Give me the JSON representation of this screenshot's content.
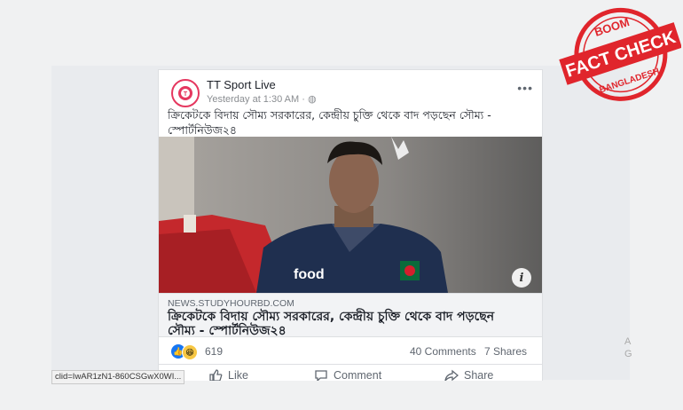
{
  "post": {
    "page_name": "TT Sport Live",
    "timestamp": "Yesterday at 1:30 AM · ",
    "more_label": "•••",
    "caption": "ক্রিকেটকে বিদায় সৌম্য সরকারের, কেন্দ্রীয় চুক্তি থেকে বাদ পড়ছেন সৌম্য - স্পোর্টনিউজ২৪",
    "info_label": "i"
  },
  "link_preview": {
    "domain": "NEWS.STUDYHOURBD.COM",
    "title": "ক্রিকেটকে বিদায় সৌম্য সরকারের, কেন্দ্রীয় চুক্তি থেকে বাদ পড়ছেন সৌম্য - স্পোর্টনিউজ২৪"
  },
  "stats": {
    "reaction_count": "619",
    "comments": "40 Comments",
    "shares": "7 Shares"
  },
  "actions": {
    "like": "Like",
    "comment": "Comment",
    "share": "Share"
  },
  "status_bar": {
    "url": "clid=IwAR1zN1-860CSGwX0WI..."
  },
  "sidebar_partial": {
    "line1": "A",
    "line2": "G"
  },
  "stamp": {
    "top_text": "BOOM",
    "main_text": "FACT CHECK",
    "bottom_text": "BANGLADESH",
    "color": "#e0252c"
  },
  "icons": {
    "globe": "globe-icon",
    "like": "thumbs-up-icon",
    "comment": "speech-bubble-icon",
    "share": "share-arrow-icon"
  }
}
